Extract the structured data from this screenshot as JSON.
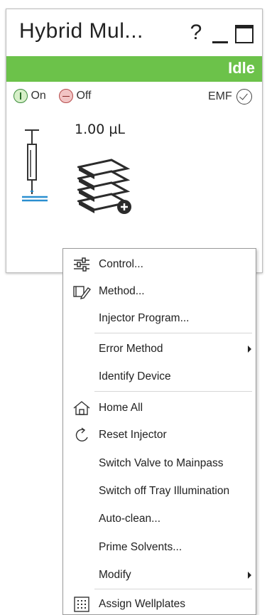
{
  "window": {
    "title": "Hybrid Mul...",
    "help_label": "?",
    "status": "Idle",
    "status_color": "#6cc24a"
  },
  "controls": {
    "on_label": "On",
    "off_label": "Off",
    "emf_label": "EMF"
  },
  "volume": "1.00 µL",
  "menu": {
    "items": [
      {
        "label": "Control...",
        "icon": "sliders-icon"
      },
      {
        "label": "Method...",
        "icon": "method-edit-icon"
      },
      {
        "label": "Injector Program..."
      },
      {
        "label": "Error Method",
        "submenu": true
      },
      {
        "label": "Identify Device"
      },
      {
        "label": "Home All",
        "icon": "home-icon"
      },
      {
        "label": "Reset Injector",
        "icon": "reset-icon"
      },
      {
        "label": "Switch Valve to Mainpass"
      },
      {
        "label": "Switch off Tray Illumination"
      },
      {
        "label": "Auto-clean..."
      },
      {
        "label": "Prime Solvents..."
      },
      {
        "label": "Modify",
        "submenu": true
      },
      {
        "label": "Assign Wellplates",
        "icon": "wellplate-grid-icon"
      }
    ]
  }
}
